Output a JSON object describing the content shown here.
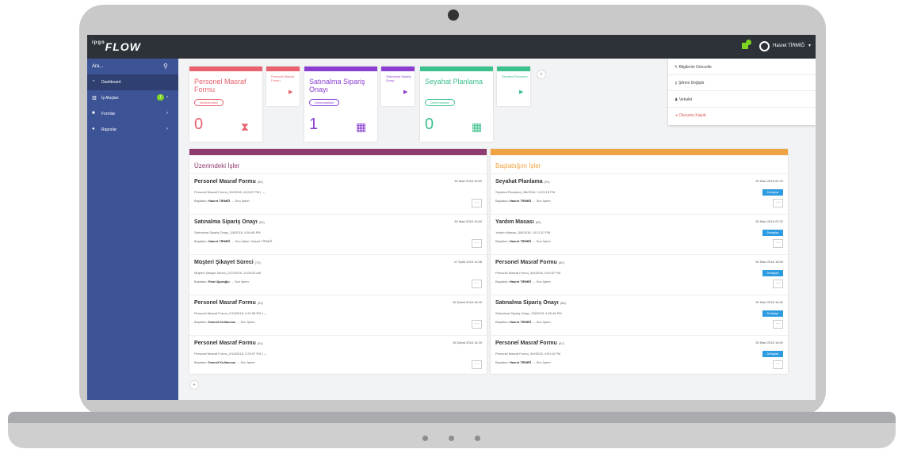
{
  "app": {
    "logo_prefix": "ipgo",
    "logo": "FLOW"
  },
  "topbar": {
    "username": "Hasret TİRMİĞ",
    "notification_count": "1"
  },
  "sidebar": {
    "search_placeholder": "Ara...",
    "items": [
      {
        "label": "Dashboard",
        "icon": "dashboard-icon"
      },
      {
        "label": "İş Akışları",
        "icon": "workflow-icon",
        "badge": "1"
      },
      {
        "label": "Formlar",
        "icon": "form-icon"
      },
      {
        "label": "Raporlar",
        "icon": "report-icon"
      }
    ]
  },
  "cards": [
    {
      "title": "Personel Masraf Formu",
      "tag": "Beklemedeki",
      "count": "0",
      "color": "#e8616c",
      "icon": "hourglass-icon"
    },
    {
      "title": "Personel Masraf Formu",
      "color": "#e8616c"
    },
    {
      "title": "Satınalma Sipariş Onayı",
      "tag": "Üzerimdekiler",
      "count": "1",
      "color": "#8a3fd1",
      "icon": "calendar-icon"
    },
    {
      "title": "Satınalma Sipariş Onayı",
      "color": "#8a3fd1"
    },
    {
      "title": "Seyahat Planlama",
      "tag": "Üzerimdekiler",
      "count": "0",
      "color": "#3cc08c",
      "icon": "calendar-icon"
    },
    {
      "title": "Seyahat Planlama",
      "color": "#3cc08c"
    }
  ],
  "panel_left": {
    "title": "Üzerimdeki İşler",
    "rows": [
      {
        "name": "Personel Masraf Formu",
        "id": "(80)",
        "date": "30 Mart 2018 10:53",
        "sub": "Personel Masraf Formu_3/6/2018, 4:53:57 PM | ---",
        "starter_label": "Başlatan:",
        "starter": "Hasret TİRMİĞ",
        "step": "Son İşlem:"
      },
      {
        "name": "Satınalma Sipariş Onayı",
        "id": "(90)",
        "date": "30 Mart 2018 10:50",
        "sub": "Satınalma Sipariş Onayı_3/6/2018, 4:50:46 PM",
        "starter_label": "Başlatan:",
        "starter": "Hasret TİRMİĞ",
        "step": "Son İşlem: Hasret TİRMİĞ"
      },
      {
        "name": "Müşteri Şikayet Süreci",
        "id": "(70)",
        "date": "27 Eylül 2019 11:08",
        "sub": "Müşteri Şikayet Süreci_2/27/2018, 11:08:29 AM",
        "starter_label": "Başlatan:",
        "starter": "Rıza Uğurağlu",
        "step": "Son İşlem:"
      },
      {
        "name": "Personel Masraf Formu",
        "id": "(63)",
        "date": "16 Şubat 2018 16:32",
        "sub": "Personel Masraf Formu_2/16/2018, 4:31:58 PM | ---",
        "starter_label": "Başlatan:",
        "starter": "Demo3 Kullanıcısı",
        "step": "Son İşlem:"
      },
      {
        "name": "Personel Masraf Formu",
        "id": "(54)",
        "date": "16 Şubat 2018 14:20",
        "sub": "Personel Masraf Formu_2/16/2018, 2:20:07 PM | ---",
        "starter_label": "Başlatan:",
        "starter": "Demo3 Kullanıcısı",
        "step": "Son İşlem:"
      }
    ]
  },
  "panel_right": {
    "title": "Başlattığım İşler",
    "go_label": "Detaylar",
    "rows": [
      {
        "name": "Seyahat Planlama",
        "id": "(91)",
        "date": "30 Mart 2018 22:23",
        "sub": "Seyahat Planlama_3/6/2018, 10:23:15 PM",
        "starter_label": "Başlatan:",
        "starter": "Hasret TİRMİĞ",
        "step": "Son İşlem:"
      },
      {
        "name": "Yardım Masası",
        "id": "(89)",
        "date": "30 Mart 2018 22:22",
        "sub": "Yardım Masası_3/6/2018, 10:21:57 PM",
        "starter_label": "Başlatan:",
        "starter": "Hasret TİRMİĞ",
        "step": "Son İşlem:"
      },
      {
        "name": "Personel Masraf Formu",
        "id": "(80)",
        "date": "30 Mart 2018 16:53",
        "sub": "Personel Masraf Formu_3/6/2018, 4:53:57 PM",
        "starter_label": "Başlatan:",
        "starter": "Hasret TİRMİĞ",
        "step": "Son İşlem:"
      },
      {
        "name": "Satınalma Sipariş Onayı",
        "id": "(88)",
        "date": "30 Mart 2018 16:50",
        "sub": "Satınalma Sipariş Onayı_3/6/2018, 4:50:46 PM",
        "starter_label": "Başlatan:",
        "starter": "Hasret TİRMİĞ",
        "step": "Son İşlem:"
      },
      {
        "name": "Personel Masraf Formu",
        "id": "(87)",
        "date": "30 Mart 2018 16:50",
        "sub": "Personel Masraf Formu_3/6/2018, 4:50:10 PM",
        "starter_label": "Başlatan:",
        "starter": "Hasret TİRMİĞ",
        "step": "Son İşlem:"
      }
    ]
  },
  "dropdown": {
    "items": [
      "Bilgilerini Güncelle",
      "Şifreni Değiştir",
      "Vekalet",
      "Oturumu Kapat"
    ]
  }
}
